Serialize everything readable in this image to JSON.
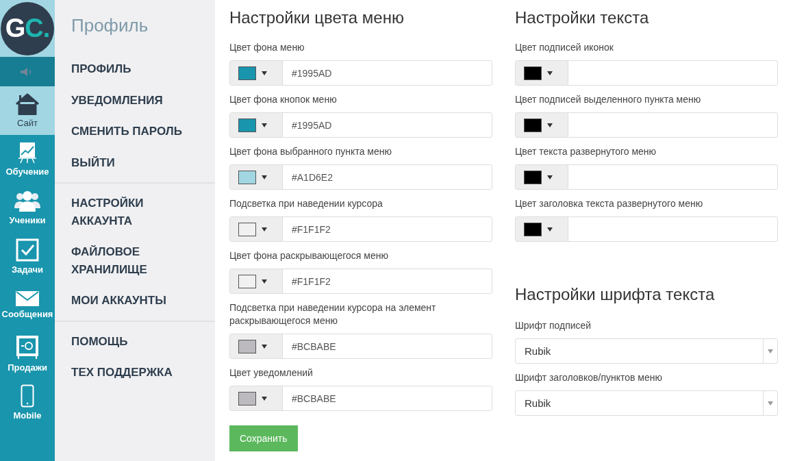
{
  "logo": {
    "text": "GC."
  },
  "rail": [
    {
      "kind": "speaker",
      "selected": false
    },
    {
      "kind": "house",
      "label": "Сайт",
      "selected": true
    },
    {
      "kind": "chart",
      "label": "Обучение",
      "selected": false
    },
    {
      "kind": "people",
      "label": "Ученики",
      "selected": false
    },
    {
      "kind": "check",
      "label": "Задачи",
      "selected": false
    },
    {
      "kind": "mail",
      "label": "Сообщения",
      "selected": false
    },
    {
      "kind": "safe",
      "label": "Продажи",
      "selected": false
    },
    {
      "kind": "phone",
      "label": "Mobile",
      "selected": false
    }
  ],
  "nav": {
    "title": "Профиль",
    "groups": [
      [
        "ПРОФИЛЬ",
        "УВЕДОМЛЕНИЯ",
        "СМЕНИТЬ ПАРОЛЬ",
        "ВЫЙТИ"
      ],
      [
        "НАСТРОЙКИ\nАККАУНТА",
        "ФАЙЛОВОЕ\nХРАНИЛИЩЕ",
        "МОИ АККАУНТЫ"
      ],
      [
        "ПОМОЩЬ",
        "ТЕХ ПОДДЕРЖКА"
      ]
    ]
  },
  "menu_colors": {
    "title": "Настройки цвета меню",
    "fields": [
      {
        "label": "Цвет фона меню",
        "color": "#1995ad",
        "value": "#1995AD"
      },
      {
        "label": "Цвет фона кнопок меню",
        "color": "#1995ad",
        "value": "#1995AD"
      },
      {
        "label": "Цвет фона выбранного пункта меню",
        "color": "#a1d6e2",
        "value": "#A1D6E2"
      },
      {
        "label": "Подсветка при наведении курсора",
        "color": "#f1f1f2",
        "value": "#F1F1F2"
      },
      {
        "label": "Цвет фона раскрывающегося меню",
        "color": "#f1f1f2",
        "value": "#F1F1F2"
      },
      {
        "label": "Подсветка при наведении курсора на элемент раскрывающегося меню",
        "color": "#bcbabe",
        "value": "#BCBABE"
      },
      {
        "label": "Цвет уведомлений",
        "color": "#bcbabe",
        "value": "#BCBABE"
      }
    ]
  },
  "save_button": "Сохранить",
  "text_colors": {
    "title": "Настройки текста",
    "fields": [
      {
        "label": "Цвет подписей иконок",
        "color": "#000000"
      },
      {
        "label": "Цвет подписей выделенного пункта меню",
        "color": "#000000"
      },
      {
        "label": "Цвет текста развернутого меню",
        "color": "#000000"
      },
      {
        "label": "Цвет заголовка текста развернутого меню",
        "color": "#000000"
      }
    ]
  },
  "fonts": {
    "title": "Настройки шрифта текста",
    "fields": [
      {
        "label": "Шрифт подписей",
        "value": "Rubik"
      },
      {
        "label": "Шрифт заголовков/пунктов меню",
        "value": "Rubik"
      }
    ]
  }
}
